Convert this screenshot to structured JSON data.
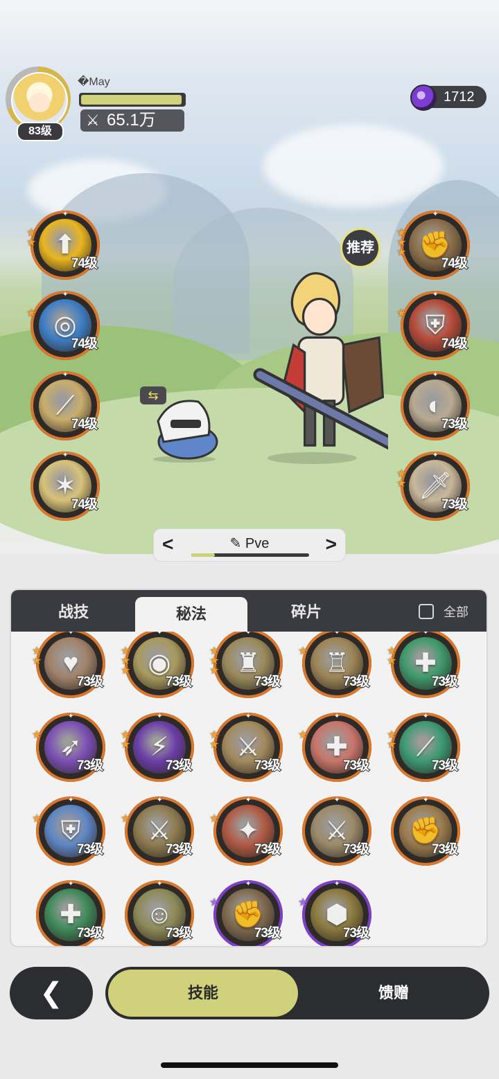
{
  "player": {
    "name": "�May",
    "level": "83级",
    "power": "65.1万",
    "exp_fraction": 0.98
  },
  "currency": {
    "value": "1712",
    "icon": "purple-gem-icon"
  },
  "recommend_label": "推荐",
  "left_skills": [
    {
      "level": "74级",
      "stars": 2,
      "icon": "golden-shield-up-icon",
      "color": "#e9b520"
    },
    {
      "level": "74级",
      "stars": 1,
      "icon": "blue-vortex-icon",
      "color": "#3e7fc5"
    },
    {
      "level": "74级",
      "stars": 0,
      "icon": "golden-slash-icon",
      "color": "#c9ad6b"
    },
    {
      "level": "74级",
      "stars": 0,
      "icon": "golden-burst-icon",
      "color": "#d8c27a"
    }
  ],
  "right_skills": [
    {
      "level": "74级",
      "stars": 3,
      "icon": "fist-strike-icon",
      "color": "#8b6f4a"
    },
    {
      "level": "74级",
      "stars": 1,
      "icon": "red-shield-icon",
      "color": "#b64b3a"
    },
    {
      "level": "73级",
      "stars": 0,
      "icon": "shield-slash-icon",
      "color": "#b8aa92"
    },
    {
      "level": "73级",
      "stars": 2,
      "icon": "dagger-icon",
      "color": "#c8b79a"
    }
  ],
  "preset": {
    "label": "Pve",
    "progress": 0.2
  },
  "tabs": {
    "items": [
      "战技",
      "秘法",
      "碎片"
    ],
    "active": 1,
    "filter_label": "全部"
  },
  "grid_skills": [
    {
      "level": "73级",
      "stars": 2,
      "icon": "heart-shield-icon",
      "color": "#a0826a",
      "ring": "#d9772d"
    },
    {
      "level": "73级",
      "stars": 3,
      "icon": "eye-icon",
      "color": "#a89a5e",
      "ring": "#d9772d"
    },
    {
      "level": "73级",
      "stars": 3,
      "icon": "armor-figure-icon",
      "color": "#9a8a5c",
      "ring": "#d9772d"
    },
    {
      "level": "73级",
      "stars": 1,
      "icon": "golden-armor-icon",
      "color": "#9d8556",
      "ring": "#d9772d"
    },
    {
      "level": "73级",
      "stars": 2,
      "icon": "heal-heart-icon",
      "color": "#3f9a6b",
      "ring": "#d9772d"
    },
    {
      "level": "73级",
      "stars": 1,
      "icon": "shadow-beast-icon",
      "color": "#7b4fb5",
      "ring": "#d9772d"
    },
    {
      "level": "73级",
      "stars": 2,
      "icon": "dark-dragon-icon",
      "color": "#6b3ea8",
      "ring": "#d9772d"
    },
    {
      "level": "73级",
      "stars": 2,
      "icon": "sword-up-icon",
      "color": "#a38a5e",
      "ring": "#d9772d"
    },
    {
      "level": "73级",
      "stars": 1,
      "icon": "sword-heal-icon",
      "color": "#c9756a",
      "ring": "#d9772d"
    },
    {
      "level": "73级",
      "stars": 2,
      "icon": "green-blade-icon",
      "color": "#3d9a72",
      "ring": "#d9772d"
    },
    {
      "level": "73级",
      "stars": 1,
      "icon": "ice-shield-icon",
      "color": "#5d86c4",
      "ring": "#d9772d"
    },
    {
      "level": "73级",
      "stars": 1,
      "icon": "golden-sword-icon",
      "color": "#8e7b50",
      "ring": "#d9772d"
    },
    {
      "level": "73级",
      "stars": 1,
      "icon": "red-crack-icon",
      "color": "#b05a44",
      "ring": "#d9772d"
    },
    {
      "level": "73级",
      "stars": 0,
      "icon": "sword-down-icon",
      "color": "#9c8a6a",
      "ring": "#d9772d"
    },
    {
      "level": "73级",
      "stars": 0,
      "icon": "muscle-icon",
      "color": "#9c7c4e",
      "ring": "#d9772d"
    },
    {
      "level": "73级",
      "stars": 0,
      "icon": "green-cross-icon",
      "color": "#3f8a5a",
      "ring": "#d9772d"
    },
    {
      "level": "73级",
      "stars": 0,
      "icon": "ally-heal-icon",
      "color": "#8d8a58",
      "ring": "#d9772d"
    },
    {
      "level": "73级",
      "stars": 1,
      "icon": "bicep-icon",
      "color": "#7f6a50",
      "ring": "#7d3fc9",
      "star_color": "#9b6cf0"
    },
    {
      "level": "73级",
      "stars": 1,
      "icon": "hexagon-emblem-icon",
      "color": "#8b7a3e",
      "ring": "#7d3fc9",
      "star_color": "#9b6cf0"
    }
  ],
  "bottom": {
    "back_icon": "chevron-left-icon",
    "skill_tab": "技能",
    "gift_tab": "馈赠"
  }
}
